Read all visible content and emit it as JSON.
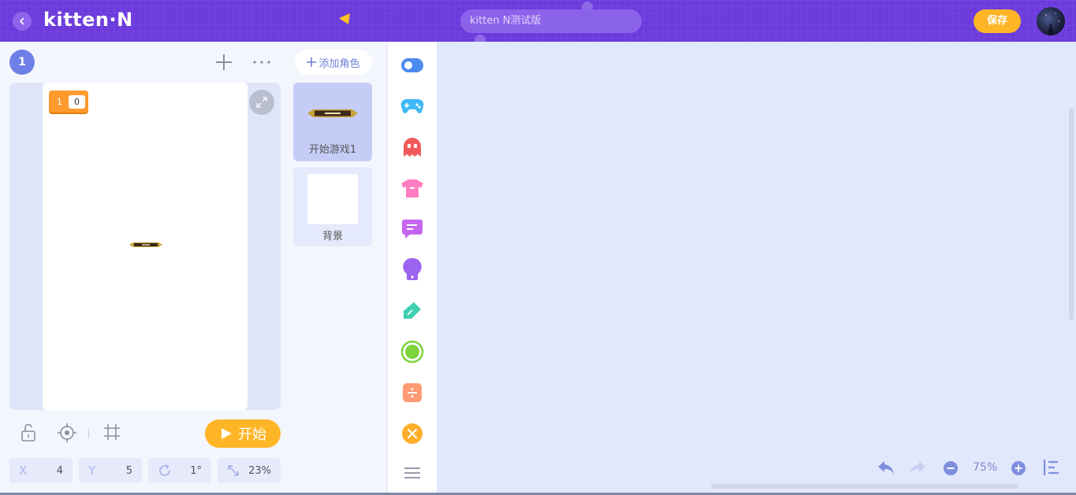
{
  "header": {
    "logo": "kitten·N",
    "project_name": "kitten N测试版",
    "save_label": "保存"
  },
  "stage": {
    "scene_number": "1",
    "variable_monitor": {
      "name": "1",
      "value": "0"
    },
    "start_label": "开始",
    "properties": {
      "x_label": "X",
      "x_value": "4",
      "y_label": "Y",
      "y_value": "5",
      "rotation_value": "1°",
      "scale_value": "23%"
    }
  },
  "sprites": {
    "add_label": "添加角色",
    "items": [
      {
        "label": "开始游戏1"
      },
      {
        "label": "背景"
      }
    ]
  },
  "categories": [
    {
      "icon": "toggle-icon",
      "color": "#4d8bf0"
    },
    {
      "icon": "gamepad-icon",
      "color": "#3fb9f5"
    },
    {
      "icon": "ghost-icon",
      "color": "#f25a5a"
    },
    {
      "icon": "shirt-icon",
      "color": "#ff7ec2"
    },
    {
      "icon": "speech-bubble-icon",
      "color": "#c566ef"
    },
    {
      "icon": "lightbulb-icon",
      "color": "#9b63ef"
    },
    {
      "icon": "pen-icon",
      "color": "#3fcfb3"
    },
    {
      "icon": "circle-icon",
      "color": "#7ed43b"
    },
    {
      "icon": "divide-icon",
      "color": "#ff9a74"
    },
    {
      "icon": "variable-icon",
      "color": "#ffae2b"
    }
  ],
  "workspace": {
    "zoom_value": "75%"
  }
}
